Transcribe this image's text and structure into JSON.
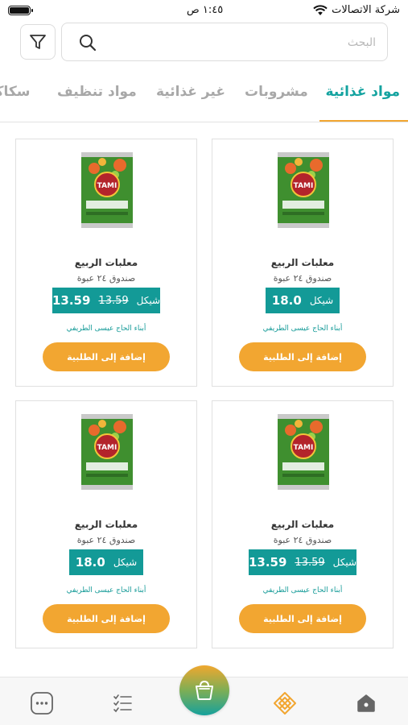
{
  "status_bar": {
    "carrier": "شركة الاتصالات",
    "time": "١:٤٥ ص"
  },
  "search": {
    "placeholder": "البحث",
    "value": ""
  },
  "tabs": [
    {
      "label": "مواد غذائية",
      "active": true
    },
    {
      "label": "مشروبات",
      "active": false
    },
    {
      "label": "غير غذائية",
      "active": false
    },
    {
      "label": "مواد تنظيف",
      "active": false
    },
    {
      "label": "سكاكر",
      "active": false
    }
  ],
  "products": [
    {
      "name": "معلبات الربيع",
      "pack": "صندوق ٢٤ عبوة",
      "price": "18.0",
      "old_price": "",
      "currency": "شيكل",
      "vendor": "أبناء الحاج عيسى الطريفي",
      "add_label": "إضافة إلى الطلبية",
      "brand_label": "TAMI"
    },
    {
      "name": "معلبات الربيع",
      "pack": "صندوق ٢٤ عبوة",
      "price": "13.59",
      "old_price": "13.59",
      "currency": "شيكل",
      "vendor": "أبناء الحاج عيسى الطريفي",
      "add_label": "إضافة إلى الطلبية",
      "brand_label": "TAMI"
    },
    {
      "name": "معلبات الربيع",
      "pack": "صندوق ٢٤ عبوة",
      "price": "13.59",
      "old_price": "13.59",
      "currency": "شيكل",
      "vendor": "أبناء الحاج عيسى الطريفي",
      "add_label": "إضافة إلى الطلبية",
      "brand_label": "TAMI"
    },
    {
      "name": "معلبات الربيع",
      "pack": "صندوق ٢٤ عبوة",
      "price": "18.0",
      "old_price": "",
      "currency": "شيكل",
      "vendor": "أبناء الحاج عيسى الطريفي",
      "add_label": "إضافة إلى الطلبية",
      "brand_label": "TAMI"
    }
  ],
  "bottom_nav": [
    {
      "icon": "home-icon"
    },
    {
      "icon": "categories-icon"
    },
    {
      "icon": "cart-icon"
    },
    {
      "icon": "orders-list-icon"
    },
    {
      "icon": "more-icon"
    }
  ],
  "colors": {
    "accent": "#139a97",
    "orange": "#f2a631",
    "tab_inactive": "#a8a8a8"
  }
}
